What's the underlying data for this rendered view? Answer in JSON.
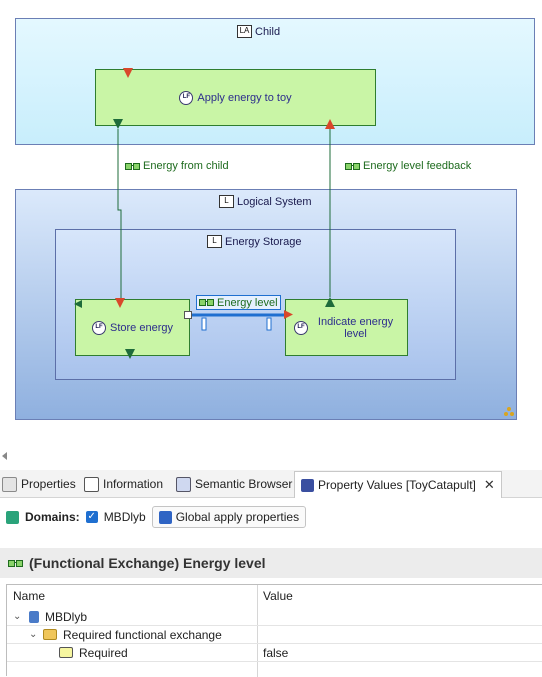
{
  "diagram": {
    "child_frame": {
      "icon": "LA",
      "title": "Child"
    },
    "logical_frame": {
      "icon": "L",
      "title": "Logical System"
    },
    "storage_frame": {
      "icon": "L",
      "title": "Energy Storage"
    },
    "functions": {
      "apply": {
        "icon": "LF",
        "label": "Apply energy to toy"
      },
      "store": {
        "icon": "LF",
        "label": "Store energy"
      },
      "indicate": {
        "icon": "LF",
        "label": "Indicate energy level"
      }
    },
    "exchanges": {
      "from_child": "Energy from child",
      "feedback": "Energy level feedback",
      "energy_level": "Energy level"
    }
  },
  "tabs": [
    {
      "label": "Properties",
      "icon": "properties-icon"
    },
    {
      "label": "Information",
      "icon": "information-icon"
    },
    {
      "label": "Semantic Browser",
      "icon": "semantic-browser-icon"
    },
    {
      "label": "Property Values [ToyCatapult]",
      "icon": "property-values-icon"
    }
  ],
  "domains": {
    "label": "Domains:",
    "checked_domain": "MBDlyb",
    "apply_button": "Global apply properties"
  },
  "header": {
    "title": "(Functional Exchange) Energy level"
  },
  "table": {
    "columns": [
      "Name",
      "Value"
    ],
    "rows": [
      {
        "name": "MBDlyb",
        "value": ""
      },
      {
        "name": "Required functional exchange",
        "value": ""
      },
      {
        "name": "Required",
        "value": "false"
      }
    ]
  }
}
